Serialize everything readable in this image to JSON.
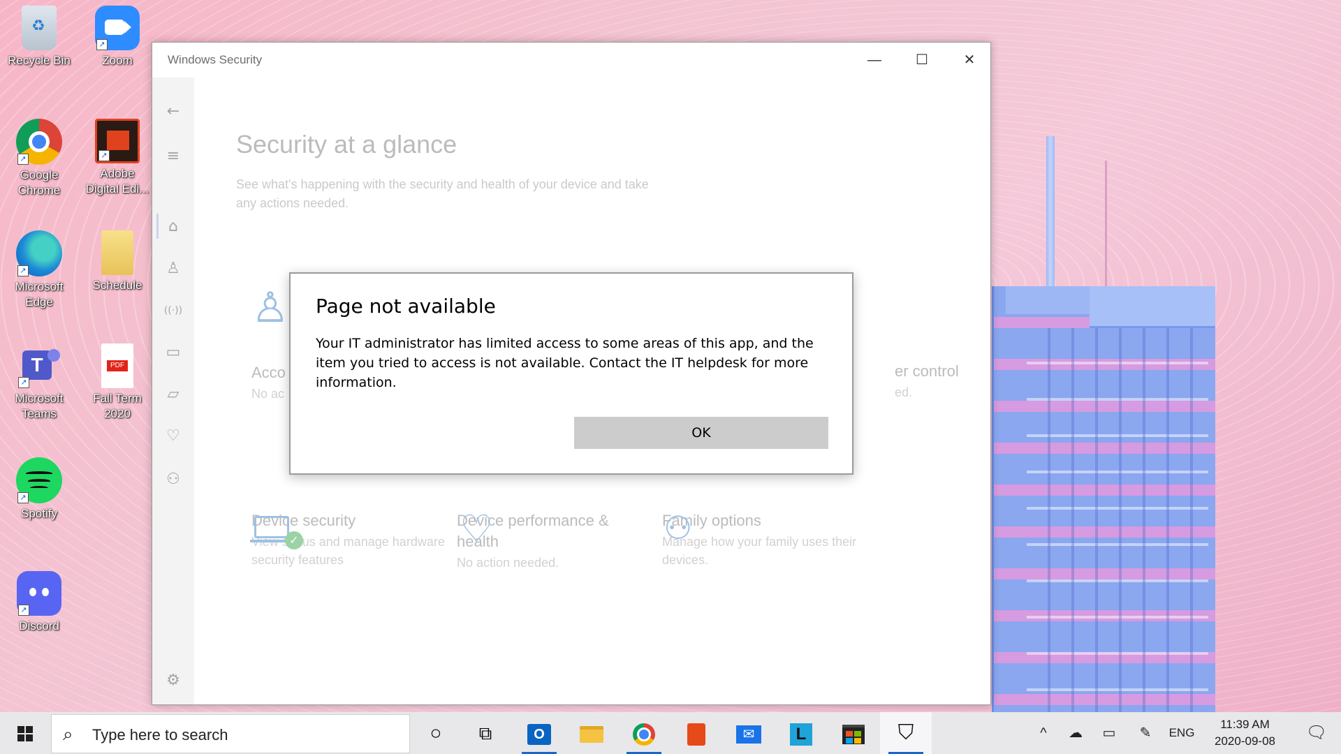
{
  "desktop": {
    "icons": [
      {
        "label": "Recycle Bin",
        "icon": "recycle-bin-icon"
      },
      {
        "label": "Zoom",
        "icon": "zoom-icon"
      },
      {
        "label": "Google Chrome",
        "icon": "chrome-icon"
      },
      {
        "label": "Adobe Digital Edi...",
        "icon": "adobe-digital-editions-icon"
      },
      {
        "label": "Microsoft Edge",
        "icon": "edge-icon"
      },
      {
        "label": "Schedule",
        "icon": "folder-icon"
      },
      {
        "label": "Microsoft Teams",
        "icon": "teams-icon"
      },
      {
        "label": "Fall Term 2020",
        "icon": "pdf-icon"
      },
      {
        "label": "Spotify",
        "icon": "spotify-icon"
      },
      {
        "label": "Discord",
        "icon": "discord-icon"
      }
    ]
  },
  "window": {
    "title": "Windows Security",
    "minimize": "—",
    "maximize": "☐",
    "close": "✕"
  },
  "sidebar": {
    "items": [
      {
        "icon": "back-arrow-icon",
        "glyph": "←"
      },
      {
        "icon": "hamburger-menu-icon",
        "glyph": "≡"
      },
      {
        "icon": "home-icon",
        "glyph": "⌂"
      },
      {
        "icon": "account-icon",
        "glyph": "♙"
      },
      {
        "icon": "network-icon",
        "glyph": "((·))"
      },
      {
        "icon": "app-browser-icon",
        "glyph": "▭"
      },
      {
        "icon": "device-security-icon",
        "glyph": "▱"
      },
      {
        "icon": "health-heart-icon",
        "glyph": "♡"
      },
      {
        "icon": "family-icon",
        "glyph": "⚇"
      },
      {
        "icon": "settings-gear-icon",
        "glyph": "⚙"
      }
    ]
  },
  "main": {
    "title": "Security at a glance",
    "subtitle": "See what's happening with the security and health of your device and take any actions needed.",
    "tiles_partial": {
      "account_title": "Acco",
      "account_desc": "No ac",
      "firewall_title": "er control",
      "firewall_desc": "ed."
    },
    "tiles": [
      {
        "title": "Device security",
        "desc": "View status and manage hardware security features",
        "icon": "laptop-check-icon"
      },
      {
        "title": "Device performance & health",
        "desc": "No action needed.",
        "icon": "heart-pulse-icon"
      },
      {
        "title": "Family options",
        "desc": "Manage how your family uses their devices.",
        "icon": "family-group-icon"
      }
    ]
  },
  "dialog": {
    "title": "Page not available",
    "body": "Your IT administrator has limited access to some areas of this app, and the item you tried to access is not available. Contact the IT helpdesk for more information.",
    "ok_label": "OK"
  },
  "taskbar": {
    "search_placeholder": "Type here to search",
    "apps": [
      {
        "icon": "cortana-icon",
        "glyph": "○"
      },
      {
        "icon": "task-view-icon",
        "glyph": "⧉"
      },
      {
        "icon": "outlook-icon",
        "glyph": "O"
      },
      {
        "icon": "file-explorer-icon",
        "glyph": "▬"
      },
      {
        "icon": "chrome-icon",
        "glyph": "◉"
      },
      {
        "icon": "office-icon",
        "glyph": "◧"
      },
      {
        "icon": "mail-icon",
        "glyph": "✉"
      },
      {
        "icon": "l-app-icon",
        "glyph": "L"
      },
      {
        "icon": "store-icon",
        "glyph": "▣"
      },
      {
        "icon": "windows-security-shield-icon",
        "glyph": "⛉"
      }
    ],
    "tray": {
      "chevron": "^",
      "language": "ENG",
      "time": "11:39 AM",
      "date": "2020-09-08"
    }
  },
  "colors": {
    "accent": "#1a66c7",
    "dialog_button": "#cccccc",
    "wallpaper_pink": "#f5c9d9",
    "building_blue": "#8aa7f0"
  }
}
